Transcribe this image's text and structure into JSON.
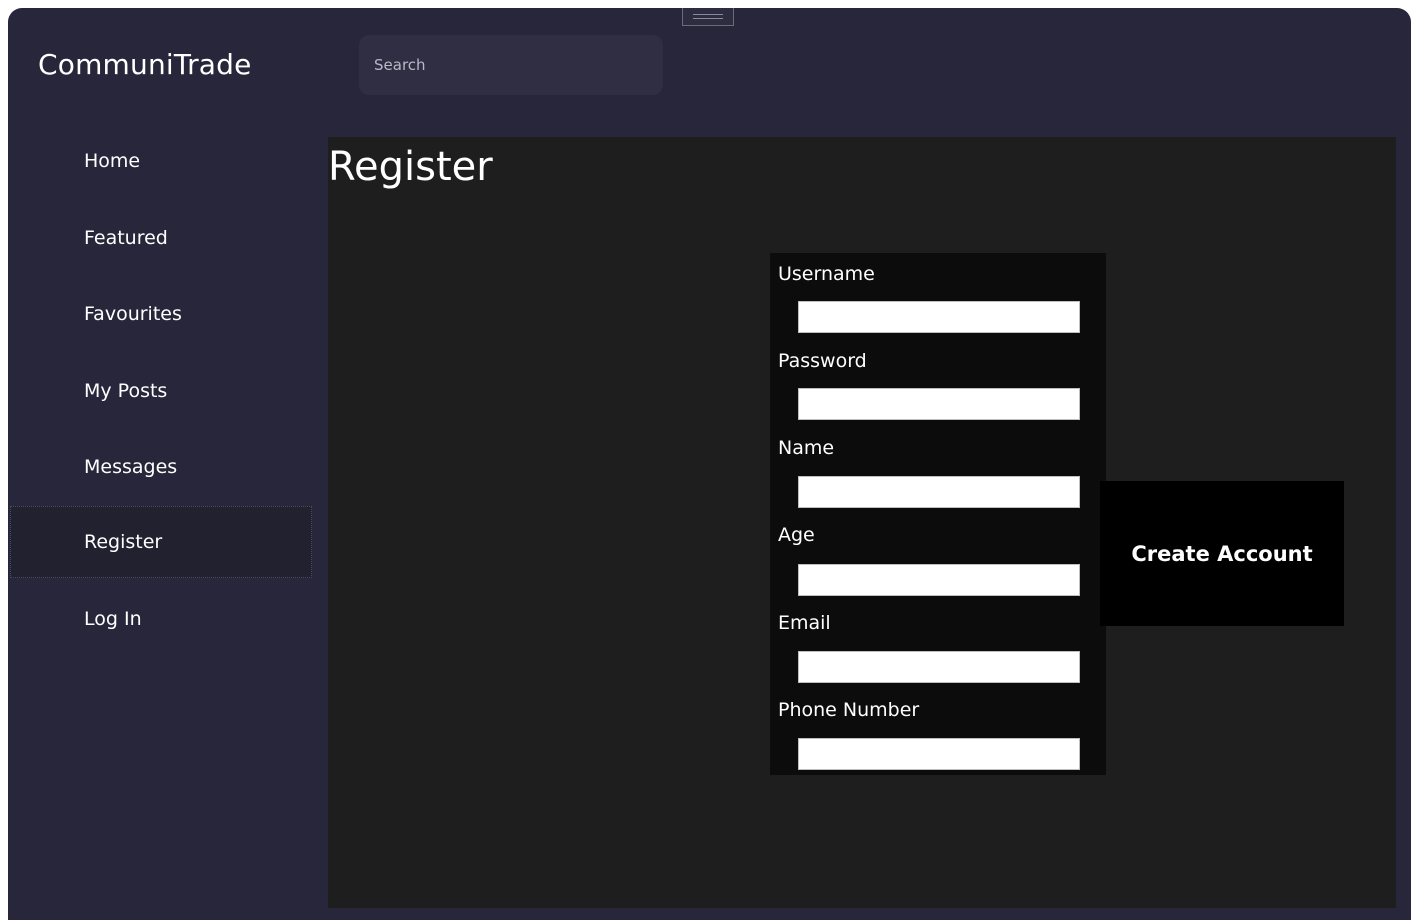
{
  "app": {
    "title": "CommuniTrade"
  },
  "search": {
    "placeholder": "Search",
    "value": ""
  },
  "sidebar": {
    "items": [
      {
        "label": "Home",
        "active": false
      },
      {
        "label": "Featured",
        "active": false
      },
      {
        "label": "Favourites",
        "active": false
      },
      {
        "label": "My Posts",
        "active": false
      },
      {
        "label": "Messages",
        "active": false
      },
      {
        "label": "Register",
        "active": true
      },
      {
        "label": "Log In",
        "active": false
      }
    ]
  },
  "main": {
    "title": "Register",
    "form": {
      "fields": [
        {
          "label": "Username",
          "value": ""
        },
        {
          "label": "Password",
          "value": ""
        },
        {
          "label": "Name",
          "value": ""
        },
        {
          "label": "Age",
          "value": ""
        },
        {
          "label": "Email",
          "value": ""
        },
        {
          "label": "Phone Number",
          "value": ""
        }
      ],
      "submit_label": "Create Account"
    }
  },
  "colors": {
    "window_background": "#28263a",
    "content_background": "#1e1e1e",
    "form_background": "#0c0c0c",
    "button_background": "#000000",
    "text": "#ffffff"
  }
}
